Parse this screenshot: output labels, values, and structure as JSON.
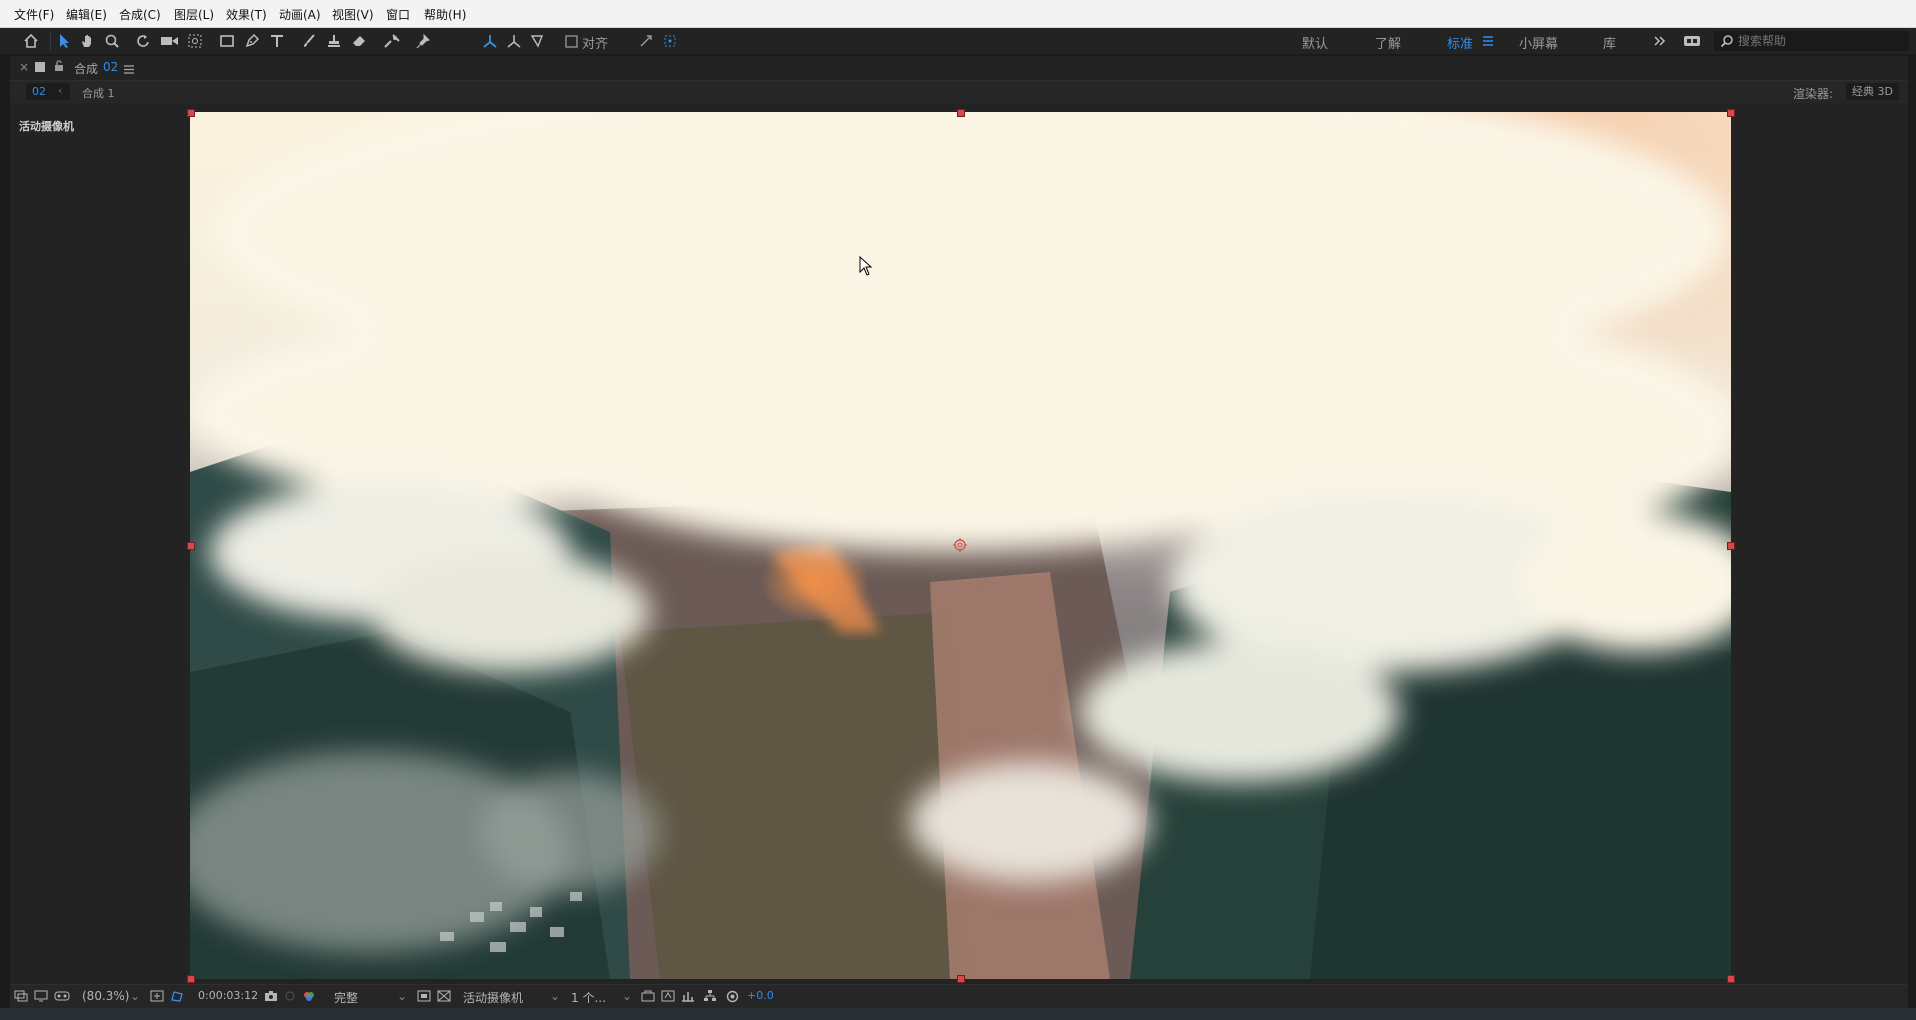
{
  "menubar": {
    "items": [
      "文件(F)",
      "编辑(E)",
      "合成(C)",
      "图层(L)",
      "效果(T)",
      "动画(A)",
      "视图(V)",
      "窗口",
      "帮助(H)"
    ]
  },
  "toolbar": {
    "snap_label": "对齐",
    "workspaces": [
      "默认",
      "了解",
      "标准",
      "小屏幕",
      "库"
    ],
    "active_workspace": "标准",
    "search_placeholder": "搜索帮助"
  },
  "panel": {
    "tab_title": "合成",
    "tab_comp_name": "02",
    "crumb_active": "02",
    "crumb_next": "合成 1",
    "renderer_label": "渲染器:",
    "renderer_value": "经典 3D",
    "camera_label": "活动摄像机"
  },
  "viewer_footer": {
    "zoom": "(80.3%)",
    "timecode": "0:00:03:12",
    "resolution": "完整",
    "camera": "活动摄像机",
    "views": "1 个...",
    "exposure": "+0.0"
  },
  "colors": {
    "accent": "#2d8ceb",
    "handle": "#d24a4a",
    "panel_bg": "#232323"
  }
}
